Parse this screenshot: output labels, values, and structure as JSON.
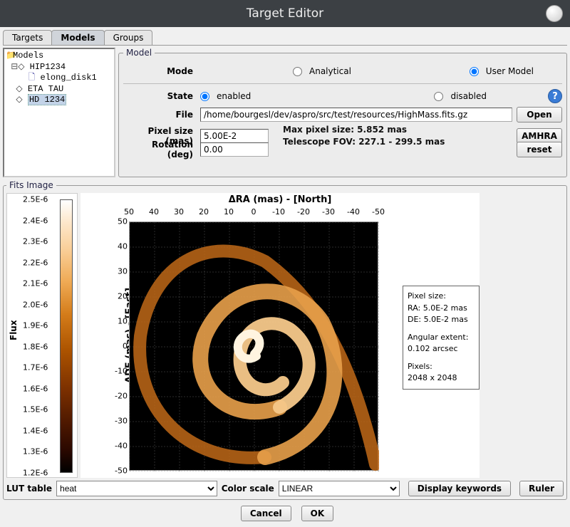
{
  "window": {
    "title": "Target Editor"
  },
  "tabs": {
    "targets": "Targets",
    "models": "Models",
    "groups": "Groups"
  },
  "tree": {
    "root": "Models",
    "t0": "HIP1234",
    "t0_child": "elong_disk1",
    "t1": "ETA TAU",
    "t2": "HD 1234"
  },
  "model": {
    "legend": "Model",
    "mode_label": "Mode",
    "mode_analytical": "Analytical",
    "mode_user": "User Model",
    "state_label": "State",
    "state_enabled": "enabled",
    "state_disabled": "disabled",
    "file_label": "File",
    "file_value": "/home/bourgesl/dev/aspro/src/test/resources/HighMass.fits.gz",
    "pixel_label": "Pixel size (mas)",
    "pixel_value": "5.00E-2",
    "rotation_label": "Rotation (deg)",
    "rotation_value": "0.00",
    "info_maxpx": "Max pixel size: 5.852 mas",
    "info_fov": "Telescope FOV: 227.1 - 299.5 mas",
    "btn_open": "Open",
    "btn_amhra": "AMHRA",
    "btn_reset": "reset"
  },
  "fits": {
    "legend": "Fits Image",
    "colorbar_label": "Flux",
    "colorbar_ticks": [
      "2.5E-6",
      "2.4E-6",
      "2.3E-6",
      "2.2E-6",
      "2.1E-6",
      "2.0E-6",
      "1.9E-6",
      "1.8E-6",
      "1.7E-6",
      "1.6E-6",
      "1.5E-6",
      "1.4E-6",
      "1.3E-6",
      "1.2E-6"
    ],
    "xaxis_title": "ΔRA (mas) - [North]",
    "yaxis_title": "ΔDE (mas) - [East]",
    "xticks": [
      "50",
      "40",
      "30",
      "20",
      "10",
      "0",
      "-10",
      "-20",
      "-30",
      "-40",
      "-50"
    ],
    "yticks": [
      "50",
      "40",
      "30",
      "20",
      "10",
      "0",
      "-10",
      "-20",
      "-30",
      "-40",
      "-50"
    ],
    "info_px_label": "Pixel size:",
    "info_px_ra": "RA: 5.0E-2 mas",
    "info_px_de": "DE: 5.0E-2 mas",
    "info_ext_label": "Angular extent:",
    "info_ext_val": "0.102 arcsec",
    "info_pixels_label": "Pixels:",
    "info_pixels_val": "2048 x 2048",
    "lut_label": "LUT table",
    "lut_value": "heat",
    "scale_label": "Color scale",
    "scale_value": "LINEAR",
    "btn_keywords": "Display keywords",
    "btn_ruler": "Ruler"
  },
  "footer": {
    "cancel": "Cancel",
    "ok": "OK"
  }
}
